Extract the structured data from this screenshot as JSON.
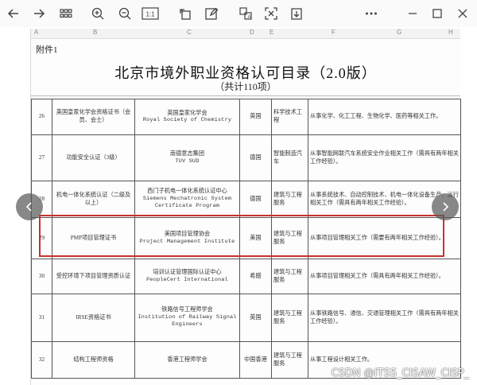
{
  "toolbar": {
    "left_icons": [
      "back-icon",
      "forward-icon",
      "thumbnail-grid-icon",
      "zoom-in-icon",
      "zoom-out-icon",
      "actual-size-icon",
      "rotate-icon",
      "edit-icon",
      "extract-text-icon",
      "scan-icon",
      "download-icon"
    ],
    "actual_size_label": "1:1",
    "right_icons": [
      "more-icon",
      "minimize-icon",
      "maximize-icon",
      "close-icon"
    ]
  },
  "document": {
    "annex": "附件1",
    "title": "北京市境外职业资格认可目录（2.0版）",
    "subtitle": "（共计110项）",
    "column_letters": [
      "A",
      "B",
      "C",
      "D",
      "E",
      "F",
      "G",
      "H"
    ],
    "rows": [
      {
        "no": "26",
        "cert": "英国皇家化学会资格证书（会员、会士）",
        "org_cn": "英国皇家化学会",
        "org_en": "Royal Society of Chemistry",
        "country": "英国",
        "field": "科学技术工程",
        "scope": "从事化学、化工工程、生物化学、医药等相关工作。"
      },
      {
        "no": "27",
        "cert": "功能安全认证（3级）",
        "org_cn": "南德意志集团",
        "org_en": "TUV SUD",
        "country": "德国",
        "field": "智能制造汽车",
        "scope": "从事智能网联汽车系统安全作业相关工作（需具有两年相关工作经验）。"
      },
      {
        "no": "28",
        "cert": "机电一体化系统认证（二级及以上）",
        "org_cn": "西门子机电一体化系统认证中心",
        "org_en": "Siemens Mechatronic System Certificate Program",
        "country": "德国",
        "field": "建筑与工程服务",
        "scope": "从事系统技术、自动控制技术、机电一体化设备生产、运行相关工作（需具有两年相关工作经验）。"
      },
      {
        "no": "29",
        "cert": "PMP项目管理证书",
        "org_cn": "美国项目管理协会",
        "org_en": "Project Management Institute",
        "country": "美国",
        "field": "建筑与工程服务",
        "scope": "从事项目管理相关工作（需要有两年相关工作经验）。"
      },
      {
        "no": "30",
        "cert": "受控环境下项目管理资质认证",
        "org_cn": "培训认证管理国际认证中心",
        "org_en": "PeopleCert International",
        "country": "希腊",
        "field": "建筑与工程服务",
        "scope": "从事项目管理相关工作（需具有两年相关工作经验）。"
      },
      {
        "no": "31",
        "cert": "IRSE资格证书",
        "org_cn": "铁路信号工程师学会",
        "org_en": "Institution of Railway Signal Engineers",
        "country": "英国",
        "field": "建筑与工程服务",
        "scope": "从事铁路信号、通信、交通管理相关工作（需具有两年相关工作经验）。"
      },
      {
        "no": "32",
        "cert": "结构工程师资格",
        "org_cn": "香港工程师学会",
        "org_en": "",
        "country": "中国香港",
        "field": "建筑与工程服务",
        "scope": "从事工程设计相关工作。"
      }
    ]
  },
  "viewer": {
    "prev_icon": "chevron-left-icon",
    "next_icon": "chevron-right-icon",
    "watermark": "CSDN @ITSS_CISAW_CISP_"
  },
  "colors": {
    "highlight_border": "#c8322d",
    "toolbar_bg": "#fafafa",
    "nav_bg": "#5a5a5a"
  }
}
